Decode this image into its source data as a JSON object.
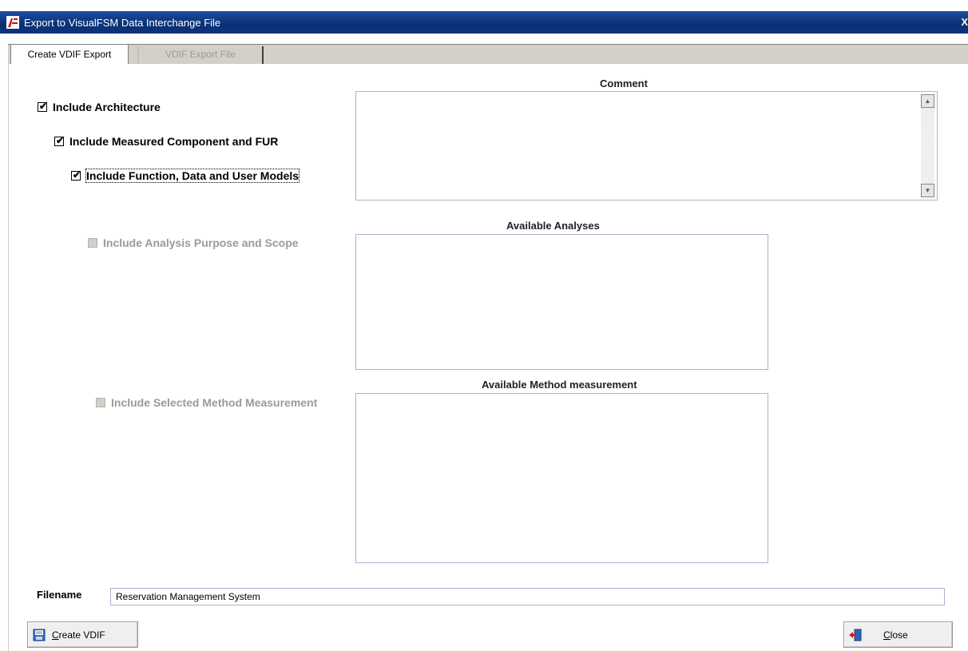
{
  "window": {
    "title": "Export to VisualFSM Data Interchange File",
    "close_glyph": "X"
  },
  "tabs": [
    {
      "label": "Create VDIF Export",
      "active": true
    },
    {
      "label": "VDIF Export File",
      "active": false
    }
  ],
  "options": {
    "include_architecture": {
      "label": "Include Architecture",
      "checked": true,
      "enabled": true
    },
    "include_measured_component": {
      "label": "Include Measured Component and FUR",
      "checked": true,
      "enabled": true
    },
    "include_function_models": {
      "label": "Include Function, Data and User  Models",
      "checked": true,
      "enabled": true
    },
    "include_analysis_purpose": {
      "label": "Include Analysis Purpose and Scope",
      "checked": false,
      "enabled": false
    },
    "include_selected_method": {
      "label": "Include Selected Method Measurement",
      "checked": false,
      "enabled": false
    }
  },
  "sections": {
    "comment": {
      "header": "Comment",
      "value": ""
    },
    "analyses": {
      "header": "Available Analyses",
      "items": []
    },
    "method": {
      "header": "Available Method measurement",
      "items": []
    }
  },
  "filename": {
    "label": "Filename",
    "value": "Reservation Management System"
  },
  "buttons": {
    "create": {
      "label": "Create VDIF",
      "icon": "save-document-icon"
    },
    "close": {
      "label": "Close",
      "icon": "exit-door-icon"
    }
  },
  "tick_glyph": "✔",
  "colors": {
    "titlebar": "#0a2f73",
    "panel_border": "#a8b4cc",
    "disabled_text": "#9a9a9a"
  }
}
